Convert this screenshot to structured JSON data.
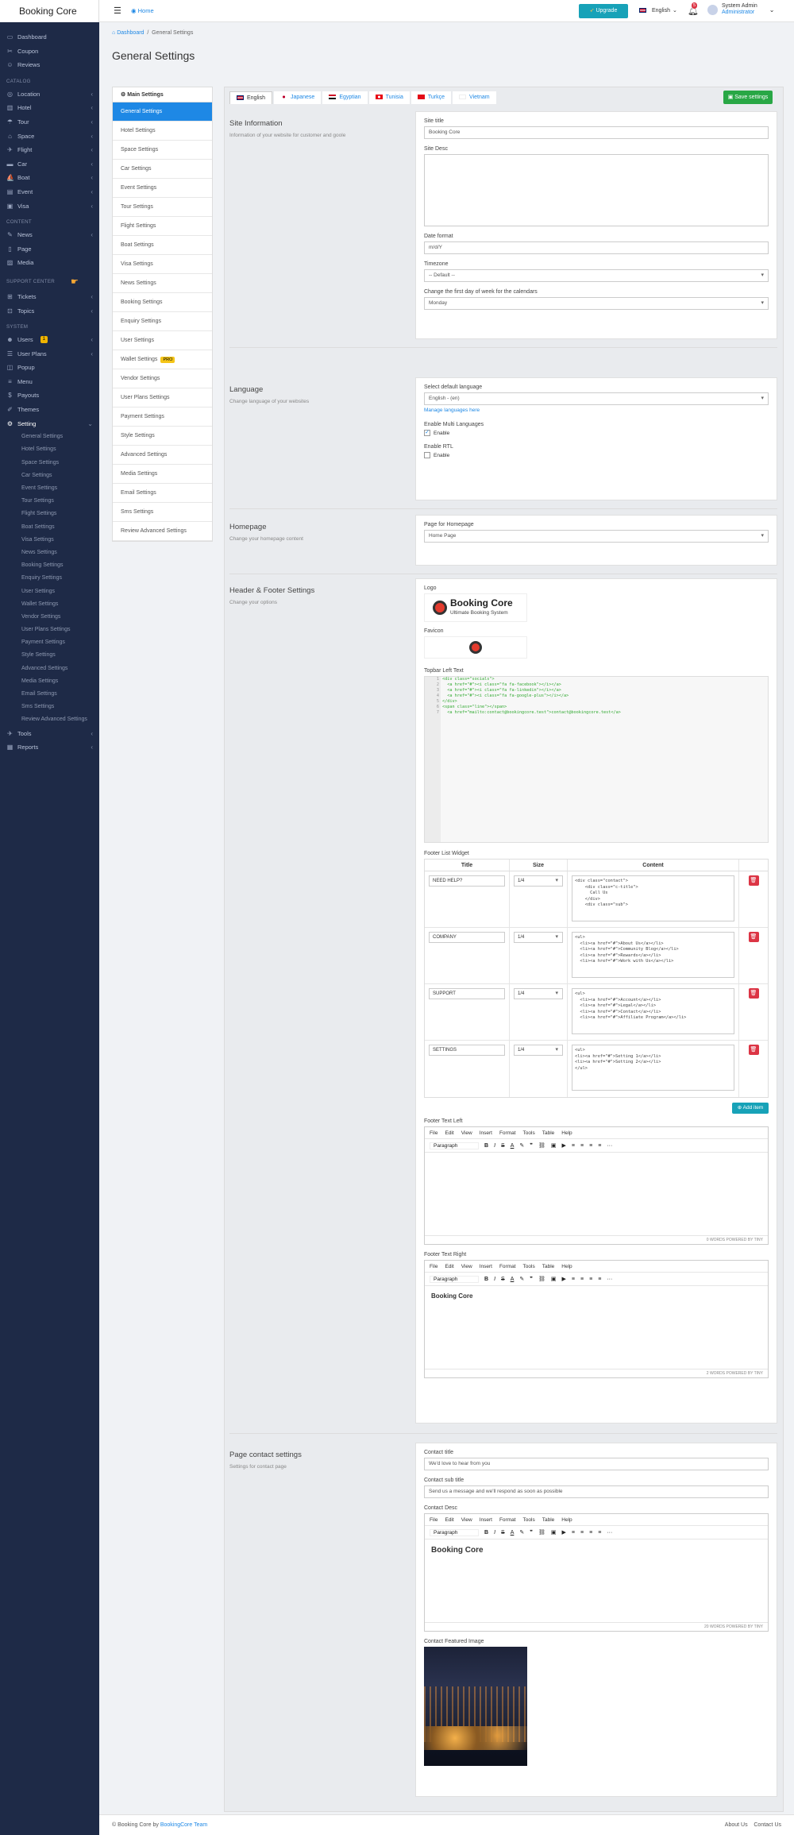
{
  "sidebar": {
    "brand": "Booking Core",
    "items_top": [
      {
        "icon": "dashboard-icon",
        "label": "Dashboard"
      },
      {
        "icon": "coupon-icon",
        "label": "Coupon"
      },
      {
        "icon": "reviews-icon",
        "label": "Reviews"
      }
    ],
    "catalog_title": "CATALOG",
    "catalog": [
      {
        "icon": "location-icon",
        "label": "Location"
      },
      {
        "icon": "hotel-icon",
        "label": "Hotel"
      },
      {
        "icon": "tour-icon",
        "label": "Tour"
      },
      {
        "icon": "space-icon",
        "label": "Space"
      },
      {
        "icon": "flight-icon",
        "label": "Flight"
      },
      {
        "icon": "car-icon",
        "label": "Car"
      },
      {
        "icon": "boat-icon",
        "label": "Boat"
      },
      {
        "icon": "event-icon",
        "label": "Event"
      },
      {
        "icon": "visa-icon",
        "label": "Visa"
      }
    ],
    "content_title": "CONTENT",
    "content": [
      {
        "icon": "news-icon",
        "label": "News"
      },
      {
        "icon": "page-icon",
        "label": "Page"
      },
      {
        "icon": "media-icon",
        "label": "Media"
      }
    ],
    "support_title": "SUPPORT CENTER",
    "support": [
      {
        "icon": "tickets-icon",
        "label": "Tickets"
      },
      {
        "icon": "topics-icon",
        "label": "Topics"
      }
    ],
    "system_title": "SYSTEM",
    "system": [
      {
        "icon": "users-icon",
        "label": "Users",
        "badge": "1"
      },
      {
        "icon": "user-plans-icon",
        "label": "User Plans"
      },
      {
        "icon": "popup-icon",
        "label": "Popup"
      },
      {
        "icon": "menu-icon",
        "label": "Menu"
      },
      {
        "icon": "payouts-icon",
        "label": "Payouts"
      },
      {
        "icon": "themes-icon",
        "label": "Themes"
      },
      {
        "icon": "setting-icon",
        "label": "Setting"
      }
    ],
    "setting_sub": [
      "General Settings",
      "Hotel Settings",
      "Space Settings",
      "Car Settings",
      "Event Settings",
      "Tour Settings",
      "Flight Settings",
      "Boat Settings",
      "Visa Settings",
      "News Settings",
      "Booking Settings",
      "Enquiry Settings",
      "User Settings",
      "Wallet Settings",
      "Vendor Settings",
      "User Plans Settings",
      "Payment Settings",
      "Style Settings",
      "Advanced Settings",
      "Media Settings",
      "Email Settings",
      "Sms Settings",
      "Review Advanced Settings"
    ],
    "bottom": [
      {
        "icon": "tools-icon",
        "label": "Tools"
      },
      {
        "icon": "reports-icon",
        "label": "Reports"
      }
    ]
  },
  "topbar": {
    "home": "Home",
    "upgrade": "Upgrade",
    "language": "English",
    "notif_count": "5",
    "user_name": "System Admin",
    "user_role": "Administrator"
  },
  "breadcrumb": {
    "dashboard": "Dashboard",
    "current": "General Settings"
  },
  "page_title": "General Settings",
  "settings_menu": {
    "header": "Main Settings",
    "items": [
      "General Settings",
      "Hotel Settings",
      "Space Settings",
      "Car Settings",
      "Event Settings",
      "Tour Settings",
      "Flight Settings",
      "Boat Settings",
      "Visa Settings",
      "News Settings",
      "Booking Settings",
      "Enquiry Settings",
      "User Settings",
      "Wallet Settings",
      "Vendor Settings",
      "User Plans Settings",
      "Payment Settings",
      "Style Settings",
      "Advanced Settings",
      "Media Settings",
      "Email Settings",
      "Sms Settings",
      "Review Advanced Settings"
    ],
    "pro_badge": "PRO"
  },
  "lang_tabs": [
    "English",
    "Japanese",
    "Egyptian",
    "Tunisia",
    "Turkçe",
    "Vietnam"
  ],
  "save_label": "Save settings",
  "site_info": {
    "heading": "Site Information",
    "desc": "Information of your website for customer and goole",
    "site_title_label": "Site title",
    "site_title_value": "Booking Core",
    "site_desc_label": "Site Desc",
    "date_format_label": "Date format",
    "date_format_value": "m/d/Y",
    "timezone_label": "Timezone",
    "timezone_value": "-- Default --",
    "week_label": "Change the first day of week for the calendars",
    "week_value": "Monday"
  },
  "language": {
    "heading": "Language",
    "desc": "Change language of your websites",
    "default_label": "Select default language",
    "default_value": "English - (en)",
    "manage_link": "Manage languages here",
    "multi_label": "Enable Multi Languages",
    "multi_check": "Enable",
    "rtl_label": "Enable RTL",
    "rtl_check": "Enable"
  },
  "homepage": {
    "heading": "Homepage",
    "desc": "Change your homepage content",
    "page_label": "Page for Homepage",
    "page_value": "Home Page"
  },
  "header_footer": {
    "heading": "Header & Footer Settings",
    "desc": "Change your options",
    "logo_label": "Logo",
    "logo_title": "Booking Core",
    "logo_sub": "Ultimate Booking System",
    "favicon_label": "Favicon",
    "topbar_label": "Topbar Left Text",
    "code_lines": [
      "<div class=\"socials\">",
      "  <a href=\"#\"><i class=\"fa fa-facebook\"></i></a>",
      "  <a href=\"#\"><i class=\"fa fa-linkedin\"></i></a>",
      "  <a href=\"#\"><i class=\"fa fa-google-plus\"></i></a>",
      "</div>",
      "<span class=\"line\"></span>",
      "  <a href=\"mailto:contact@bookingcore.test\">contact@bookingcore.test</a>"
    ],
    "widget_label": "Footer List Widget",
    "widget_cols": [
      "Title",
      "Size",
      "Content"
    ],
    "widgets": [
      {
        "title": "NEED HELP?",
        "size": "1/4",
        "content": "<div class=\"contact\">\n    <div class=\"c-title\">\n      Call Us\n    </div>\n    <div class=\"sub\">"
      },
      {
        "title": "COMPANY",
        "size": "1/4",
        "content": "<ul>\n  <li><a href=\"#\">About Us</a></li>\n  <li><a href=\"#\">Community Blog</a></li>\n  <li><a href=\"#\">Rewards</a></li>\n  <li><a href=\"#\">Work with Us</a></li>"
      },
      {
        "title": "SUPPORT",
        "size": "1/4",
        "content": "<ul>\n  <li><a href=\"#\">Account</a></li>\n  <li><a href=\"#\">Legal</a></li>\n  <li><a href=\"#\">Contact</a></li>\n  <li><a href=\"#\">Affiliate Program</a></li>"
      },
      {
        "title": "SETTINGS",
        "size": "1/4",
        "content": "<ul>\n<li><a href=\"#\">Setting 1</a></li>\n<li><a href=\"#\">Setting 2</a></li>\n</ul>"
      }
    ],
    "add_item": "Add item",
    "footer_left_label": "Footer Text Left",
    "footer_left_status": "0 WORDS  POWERED BY TINY",
    "footer_right_label": "Footer Text Right",
    "footer_right_text": "Booking Core",
    "footer_right_status": "2 WORDS  POWERED BY TINY"
  },
  "editor": {
    "menu": [
      "File",
      "Edit",
      "View",
      "Insert",
      "Format",
      "Tools",
      "Table",
      "Help"
    ],
    "block": "Paragraph"
  },
  "contact": {
    "heading": "Page contact settings",
    "desc": "Settings for contact page",
    "title_label": "Contact title",
    "title_value": "We'd love to hear from you",
    "sub_label": "Contact sub title",
    "sub_value": "Send us a message and we'll respond as soon as possible",
    "desc_label": "Contact Desc",
    "desc_text": "Booking Core",
    "desc_status": "20 WORDS  POWERED BY TINY",
    "image_label": "Contact Featured Image"
  },
  "footer": {
    "copyright": "© Booking Core by",
    "team": "BookingCore Team",
    "about": "About Us",
    "contact": "Contact Us"
  }
}
